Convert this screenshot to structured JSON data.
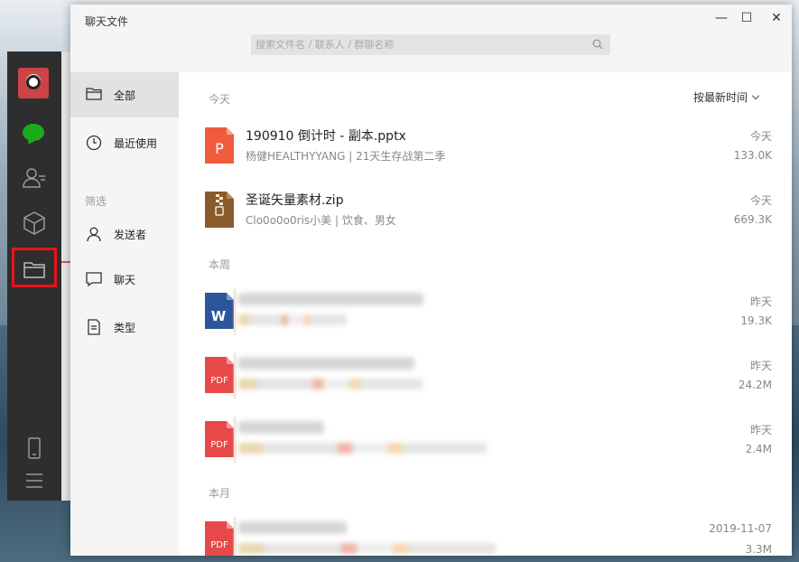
{
  "window": {
    "title": "聊天文件",
    "minimize": "—",
    "maximize": "☐",
    "close": "✕"
  },
  "search": {
    "placeholder": "搜索文件名 / 联系人 / 群聊名称"
  },
  "sidebar": {
    "icons": [
      "chat-icon",
      "contacts-icon",
      "box-icon",
      "folder-icon",
      "phone-icon",
      "menu-icon"
    ]
  },
  "nav": {
    "all": "全部",
    "recent": "最近使用",
    "filter_label": "筛选",
    "sender": "发送者",
    "chat": "聊天",
    "type": "类型"
  },
  "sort": {
    "label": "按最新时间"
  },
  "groups": {
    "today": "今天",
    "week": "本周",
    "month": "本月"
  },
  "files": [
    {
      "type": "P",
      "color": "#f05b3c",
      "name": "190910  倒计时  - 副本.pptx",
      "sub": "杨健HEALTHYYANG | 21天生存战第二季",
      "date": "今天",
      "size": "133.0K"
    },
    {
      "type": "zip",
      "color": "#8a5a2c",
      "name": "圣诞矢量素材.zip",
      "sub": "Clo0o0o0ris小美 | 饮食、男女",
      "date": "今天",
      "size": "669.3K"
    },
    {
      "type": "W",
      "color": "#2b579a",
      "name": "",
      "sub": "",
      "date": "昨天",
      "size": "19.3K"
    },
    {
      "type": "PDF",
      "color": "#e7484a",
      "name": "",
      "sub": "",
      "date": "昨天",
      "size": "24.2M"
    },
    {
      "type": "PDF",
      "color": "#e7484a",
      "name": "",
      "sub": "",
      "date": "昨天",
      "size": "2.4M"
    },
    {
      "type": "PDF",
      "color": "#e7484a",
      "name": "",
      "sub": "",
      "date": "2019-11-07",
      "size": "3.3M"
    }
  ]
}
